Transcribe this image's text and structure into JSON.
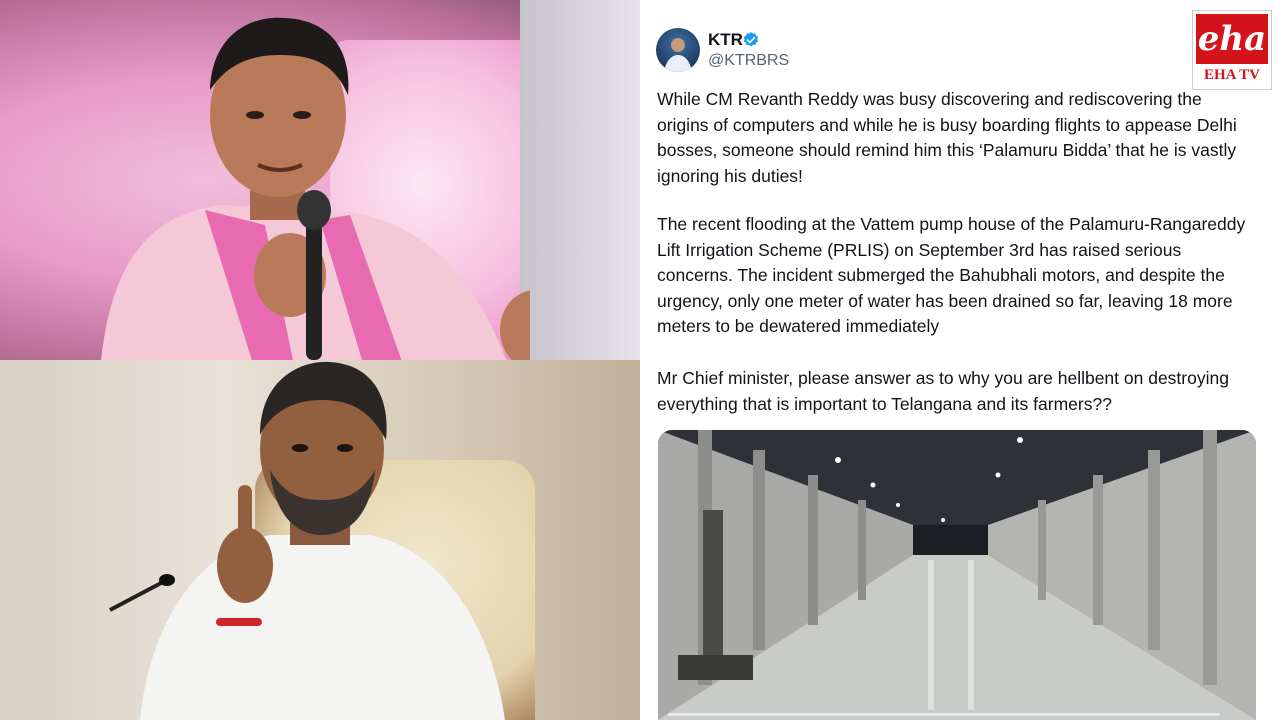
{
  "tweet": {
    "author": {
      "name": "KTR",
      "handle": "@KTRBRS",
      "verified": true
    },
    "paragraphs": [
      "While CM Revanth Reddy was busy discovering and rediscovering the origins of computers and while he is busy boarding flights to appease Delhi bosses, someone should remind him this ‘Palamuru Bidda’ that he is vastly ignoring his duties!",
      "The recent flooding at the Vattem pump house of the Palamuru-Rangareddy Lift Irrigation Scheme (PRLIS) on September 3rd has raised serious concerns. The incident submerged the Bahubhali motors, and despite the urgency, only one meter of water has been drained so far, leaving 18 more meters to be dewatered immediately",
      "Mr Chief minister, please answer as to why you are hellbent on destroying everything that is important to Telangana and its farmers??"
    ],
    "video": {
      "icon": "play-video"
    }
  },
  "logo": {
    "mark": "eha",
    "text": "EHA TV",
    "color": "#d3141b"
  },
  "colors": {
    "verified": "#1d9bf0",
    "text": "#0f1419",
    "muted": "#536471"
  }
}
